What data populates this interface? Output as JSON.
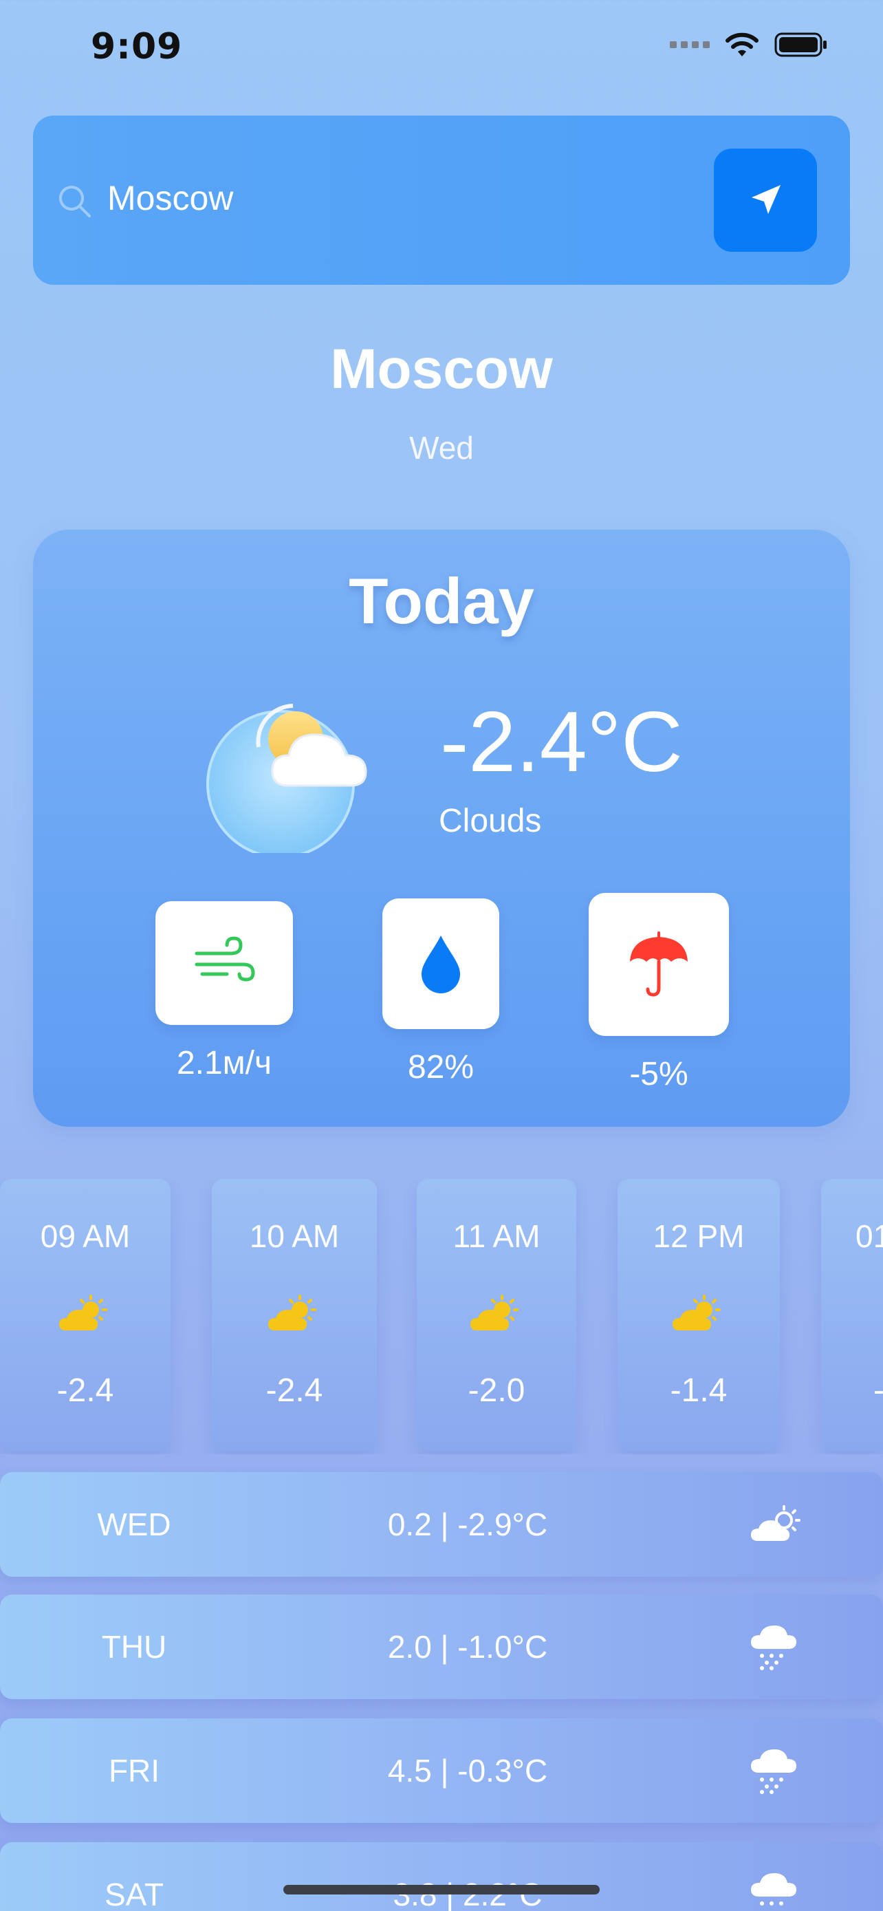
{
  "status_bar": {
    "time": "9:09"
  },
  "search": {
    "value": "Moscow",
    "placeholder": ""
  },
  "location": {
    "city": "Moscow",
    "day": "Wed"
  },
  "today": {
    "title": "Today",
    "temperature": "-2.4°C",
    "condition": "Clouds",
    "wind": "2.1м/ч",
    "humidity": "82%",
    "precipitation": "-5%"
  },
  "hourly": [
    {
      "time": "09 AM",
      "temp": "-2.4",
      "icon": "partly-cloudy-icon"
    },
    {
      "time": "10 AM",
      "temp": "-2.4",
      "icon": "partly-cloudy-icon"
    },
    {
      "time": "11 AM",
      "temp": "-2.0",
      "icon": "partly-cloudy-icon"
    },
    {
      "time": "12 PM",
      "temp": "-1.4",
      "icon": "partly-cloudy-icon"
    },
    {
      "time": "01",
      "temp": "-",
      "icon": "partly-cloudy-icon"
    }
  ],
  "daily": [
    {
      "day": "WED",
      "range": "0.2 | -2.9°C",
      "icon": "partly-cloudy-icon"
    },
    {
      "day": "THU",
      "range": "2.0 | -1.0°C",
      "icon": "snow-cloud-icon"
    },
    {
      "day": "FRI",
      "range": "4.5 | -0.3°C",
      "icon": "snow-cloud-icon"
    },
    {
      "day": "SAT",
      "range": "3.8 | 2.2°C",
      "icon": "snow-cloud-icon"
    }
  ],
  "colors": {
    "accent": "#0A7BF7",
    "wind_icon": "#34C759",
    "drop_icon": "#0A7BF7",
    "umbrella_icon": "#FF3B30",
    "sun": "#F5C518"
  }
}
